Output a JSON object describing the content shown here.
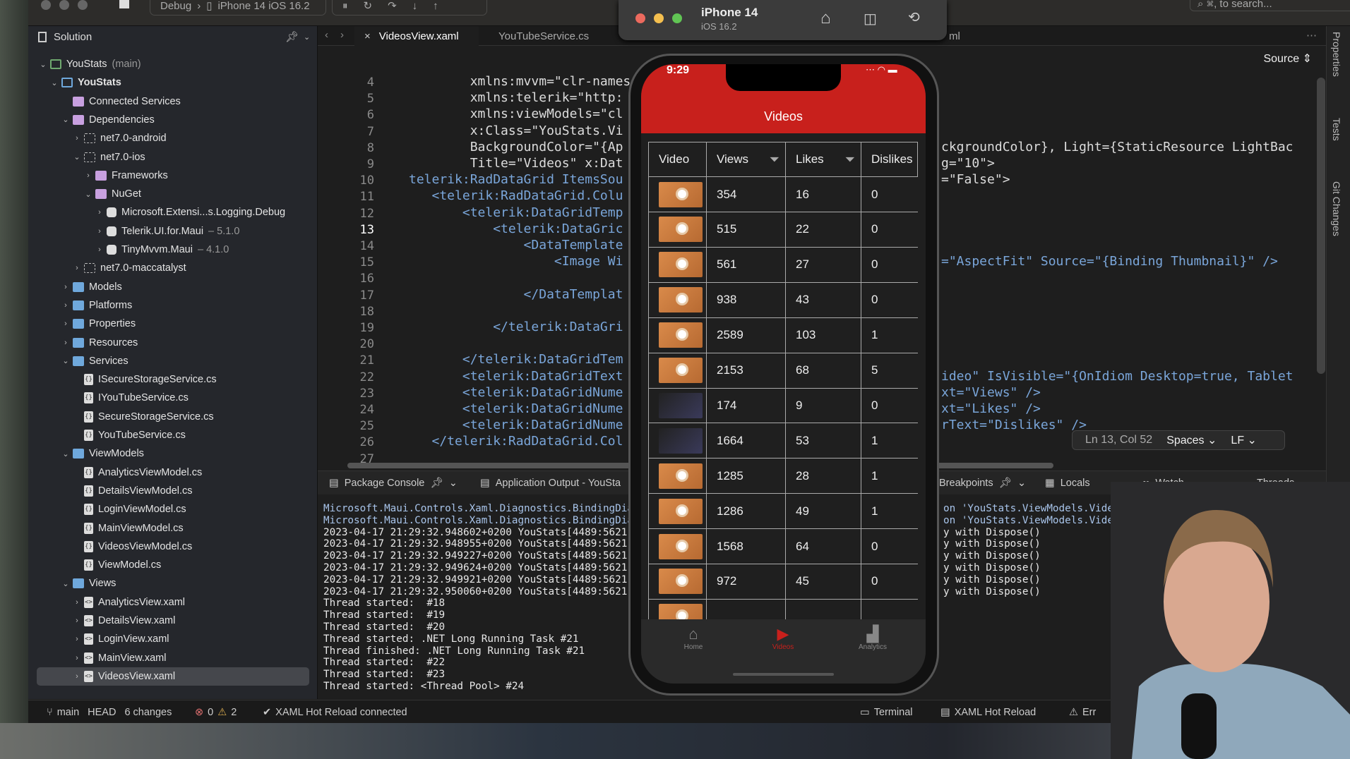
{
  "toolbar": {
    "config": "Debug",
    "device": "iPhone 14 iOS 16.2",
    "search_placeholder": "⌘, to search..."
  },
  "simulator": {
    "device": "iPhone 14",
    "os": "iOS 16.2"
  },
  "sidebar": {
    "title": "Solution",
    "items": [
      {
        "level": 0,
        "chev": "down",
        "icon": "proj",
        "label": "YouStats",
        "suffix": "(main)"
      },
      {
        "level": 1,
        "chev": "down",
        "icon": "proj2",
        "label": "YouStats",
        "bold": true
      },
      {
        "level": 2,
        "chev": "",
        "icon": "pfolder",
        "label": "Connected Services"
      },
      {
        "level": 2,
        "chev": "down",
        "icon": "pfolder",
        "label": "Dependencies"
      },
      {
        "level": 3,
        "chev": "right",
        "icon": "dep",
        "label": "net7.0-android"
      },
      {
        "level": 3,
        "chev": "down",
        "icon": "dep",
        "label": "net7.0-ios"
      },
      {
        "level": 4,
        "chev": "right",
        "icon": "pfolder",
        "label": "Frameworks"
      },
      {
        "level": 4,
        "chev": "down",
        "icon": "pfolder",
        "label": "NuGet"
      },
      {
        "level": 5,
        "chev": "right",
        "icon": "pkg",
        "label": "Microsoft.Extensi...s.Logging.Debug"
      },
      {
        "level": 5,
        "chev": "right",
        "icon": "pkg",
        "label": "Telerik.UI.for.Maui",
        "suffix": "– 5.1.0"
      },
      {
        "level": 5,
        "chev": "right",
        "icon": "pkg",
        "label": "TinyMvvm.Maui",
        "suffix": "– 4.1.0"
      },
      {
        "level": 3,
        "chev": "right",
        "icon": "dep",
        "label": "net7.0-maccatalyst"
      },
      {
        "level": 2,
        "chev": "right",
        "icon": "folder",
        "label": "Models"
      },
      {
        "level": 2,
        "chev": "right",
        "icon": "folder",
        "label": "Platforms"
      },
      {
        "level": 2,
        "chev": "right",
        "icon": "folder",
        "label": "Properties"
      },
      {
        "level": 2,
        "chev": "right",
        "icon": "folder",
        "label": "Resources"
      },
      {
        "level": 2,
        "chev": "down",
        "icon": "folder",
        "label": "Services"
      },
      {
        "level": 3,
        "chev": "",
        "icon": "file",
        "label": "ISecureStorageService.cs"
      },
      {
        "level": 3,
        "chev": "",
        "icon": "file",
        "label": "IYouTubeService.cs"
      },
      {
        "level": 3,
        "chev": "",
        "icon": "file",
        "label": "SecureStorageService.cs"
      },
      {
        "level": 3,
        "chev": "",
        "icon": "file",
        "label": "YouTubeService.cs"
      },
      {
        "level": 2,
        "chev": "down",
        "icon": "folder",
        "label": "ViewModels"
      },
      {
        "level": 3,
        "chev": "",
        "icon": "file",
        "label": "AnalyticsViewModel.cs"
      },
      {
        "level": 3,
        "chev": "",
        "icon": "file",
        "label": "DetailsViewModel.cs"
      },
      {
        "level": 3,
        "chev": "",
        "icon": "file",
        "label": "LoginViewModel.cs"
      },
      {
        "level": 3,
        "chev": "",
        "icon": "file",
        "label": "MainViewModel.cs"
      },
      {
        "level": 3,
        "chev": "",
        "icon": "file",
        "label": "VideosViewModel.cs"
      },
      {
        "level": 3,
        "chev": "",
        "icon": "file",
        "label": "ViewModel.cs"
      },
      {
        "level": 2,
        "chev": "down",
        "icon": "folder",
        "label": "Views"
      },
      {
        "level": 3,
        "chev": "right",
        "icon": "xfile",
        "label": "AnalyticsView.xaml"
      },
      {
        "level": 3,
        "chev": "right",
        "icon": "xfile",
        "label": "DetailsView.xaml"
      },
      {
        "level": 3,
        "chev": "right",
        "icon": "xfile",
        "label": "LoginView.xaml"
      },
      {
        "level": 3,
        "chev": "right",
        "icon": "xfile",
        "label": "MainView.xaml"
      },
      {
        "level": 3,
        "chev": "right",
        "icon": "xfile",
        "label": "VideosView.xaml",
        "selected": true
      }
    ]
  },
  "tabs": [
    {
      "label": "VideosView.xaml",
      "active": true
    },
    {
      "label": "YouTubeService.cs"
    },
    {
      "label": "ml"
    }
  ],
  "editor": {
    "source_label": "Source",
    "current_line": 13,
    "lines": [
      {
        "n": 4,
        "left": "        xmlns:mvvm=\"clr-names"
      },
      {
        "n": 5,
        "left": "        xmlns:telerik=\"http:"
      },
      {
        "n": 6,
        "left": "        xmlns:viewModels=\"cl"
      },
      {
        "n": 7,
        "left": "        x:Class=\"YouStats.Vi"
      },
      {
        "n": 8,
        "left": "        BackgroundColor=\"{Ap",
        "right": "ckgroundColor}, Light={StaticResource LightBac"
      },
      {
        "n": 9,
        "left": "        Title=\"Videos\" x:Dat",
        "right": "g=\"10\">"
      },
      {
        "n": 10,
        "left": "telerik:RadDataGrid ItemsSou",
        "tag": true,
        "right": "=\"False\">"
      },
      {
        "n": 11,
        "left": "   <telerik:RadDataGrid.Colu",
        "tag": true
      },
      {
        "n": 12,
        "left": "       <telerik:DataGridTemp",
        "tag": true
      },
      {
        "n": 13,
        "left": "           <telerik:DataGric",
        "tag": true
      },
      {
        "n": 14,
        "left": "               <DataTemplate",
        "tag": true
      },
      {
        "n": 15,
        "left": "                   <Image Wi",
        "tag": true,
        "right": "=\"AspectFit\" Source=\"{Binding Thumbnail}\" />"
      },
      {
        "n": 16,
        "left": ""
      },
      {
        "n": 17,
        "left": "               </DataTemplat",
        "tag": true
      },
      {
        "n": 18,
        "left": ""
      },
      {
        "n": 19,
        "left": "           </telerik:DataGri",
        "tag": true
      },
      {
        "n": 20,
        "left": ""
      },
      {
        "n": 21,
        "left": "       </telerik:DataGridTem",
        "tag": true
      },
      {
        "n": 22,
        "left": "       <telerik:DataGridText",
        "tag": true,
        "right": "ideo\" IsVisible=\"{OnIdiom Desktop=true, Tablet"
      },
      {
        "n": 23,
        "left": "       <telerik:DataGridNume",
        "tag": true,
        "right": "xt=\"Views\" />"
      },
      {
        "n": 24,
        "left": "       <telerik:DataGridNume",
        "tag": true,
        "right": "xt=\"Likes\" />"
      },
      {
        "n": 25,
        "left": "       <telerik:DataGridNume",
        "tag": true,
        "right": "rText=\"Dislikes\" />"
      },
      {
        "n": 26,
        "left": "   </telerik:RadDataGrid.Col",
        "tag": true
      },
      {
        "n": 27,
        "left": ""
      }
    ],
    "status": {
      "position": "Ln 13, Col 52",
      "indent": "Spaces",
      "eol": "LF"
    }
  },
  "panel": {
    "tabs": [
      "Package Console",
      "Application Output - YouSta",
      "Breakpoints",
      "Locals",
      "Watch",
      "Threads"
    ],
    "output": [
      {
        "t": "Microsoft.Maui.Controls.Xaml.Diagnostics.BindingDia",
        "blue": true,
        "r": "on 'YouStats.ViewModels.VideosViewMode"
      },
      {
        "t": "Microsoft.Maui.Controls.Xaml.Diagnostics.BindingDia",
        "blue": true,
        "r": "on 'YouStats.ViewModels.VideosViewMode"
      },
      {
        "t": "2023-04-17 21:29:32.948602+0200 YouStats[4489:5621",
        "r": "y with Dispose()"
      },
      {
        "t": "2023-04-17 21:29:32.948955+0200 YouStats[4489:5621",
        "r": "y with Dispose()"
      },
      {
        "t": "2023-04-17 21:29:32.949227+0200 YouStats[4489:5621",
        "r": "y with Dispose()"
      },
      {
        "t": "2023-04-17 21:29:32.949624+0200 YouStats[4489:5621",
        "r": "y with Dispose()"
      },
      {
        "t": "2023-04-17 21:29:32.949921+0200 YouStats[4489:5621",
        "r": "y with Dispose()"
      },
      {
        "t": "2023-04-17 21:29:32.950060+0200 YouStats[4489:5621",
        "r": "y with Dispose()"
      },
      {
        "t": "Thread started:  #18"
      },
      {
        "t": "Thread started:  #19"
      },
      {
        "t": "Thread started:  #20"
      },
      {
        "t": "Thread started: .NET Long Running Task #21"
      },
      {
        "t": "Thread finished: .NET Long Running Task #21"
      },
      {
        "t": "Thread started:  #22"
      },
      {
        "t": "Thread started:  #23"
      },
      {
        "t": "Thread started: <Thread Pool> #24"
      }
    ]
  },
  "statusbar": {
    "branch": "main",
    "head": "HEAD",
    "changes": "6 changes",
    "errors": "0",
    "warnings": "2",
    "hot_reload": "XAML Hot Reload connected",
    "terminal": "Terminal",
    "xaml_hot_reload": "XAML Hot Reload",
    "errors_tab": "Err"
  },
  "right_tabs": [
    "Properties",
    "Tests",
    "Git Changes"
  ],
  "app": {
    "time": "9:29",
    "title": "Videos",
    "accent": "#c8201c",
    "columns": [
      "Video",
      "Views",
      "Likes",
      "Dislikes"
    ],
    "rows": [
      {
        "thumb": "orange",
        "views": "354",
        "likes": "16",
        "dislikes": "0"
      },
      {
        "thumb": "orange",
        "views": "515",
        "likes": "22",
        "dislikes": "0"
      },
      {
        "thumb": "orange",
        "views": "561",
        "likes": "27",
        "dislikes": "0"
      },
      {
        "thumb": "orange",
        "views": "938",
        "likes": "43",
        "dislikes": "0"
      },
      {
        "thumb": "orange",
        "views": "2589",
        "likes": "103",
        "dislikes": "1"
      },
      {
        "thumb": "orange",
        "views": "2153",
        "likes": "68",
        "dislikes": "5"
      },
      {
        "thumb": "dark",
        "views": "174",
        "likes": "9",
        "dislikes": "0"
      },
      {
        "thumb": "dark",
        "views": "1664",
        "likes": "53",
        "dislikes": "1"
      },
      {
        "thumb": "orange",
        "views": "1285",
        "likes": "28",
        "dislikes": "1"
      },
      {
        "thumb": "orange",
        "views": "1286",
        "likes": "49",
        "dislikes": "1"
      },
      {
        "thumb": "orange",
        "views": "1568",
        "likes": "64",
        "dislikes": "0"
      },
      {
        "thumb": "orange",
        "views": "972",
        "likes": "45",
        "dislikes": "0"
      }
    ],
    "tabbar": [
      {
        "label": "Home",
        "icon": "home-icon"
      },
      {
        "label": "Videos",
        "icon": "video-icon",
        "active": true
      },
      {
        "label": "Analytics",
        "icon": "chart-icon"
      }
    ]
  }
}
